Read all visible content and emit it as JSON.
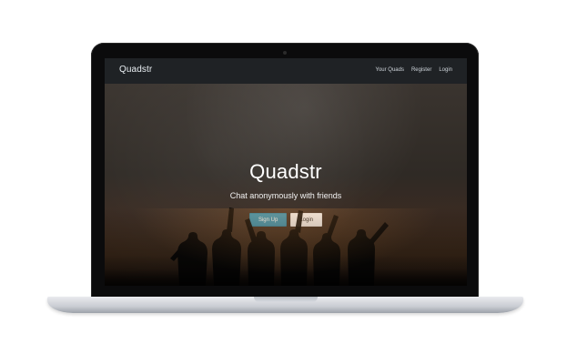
{
  "site": {
    "brand": "Quadstr",
    "nav": [
      "Your Quads",
      "Register",
      "Login"
    ],
    "hero": {
      "title": "Quadstr",
      "subtitle": "Chat anonymously with friends",
      "buttons": {
        "signup": "Sign Up",
        "login": "Login"
      }
    }
  }
}
